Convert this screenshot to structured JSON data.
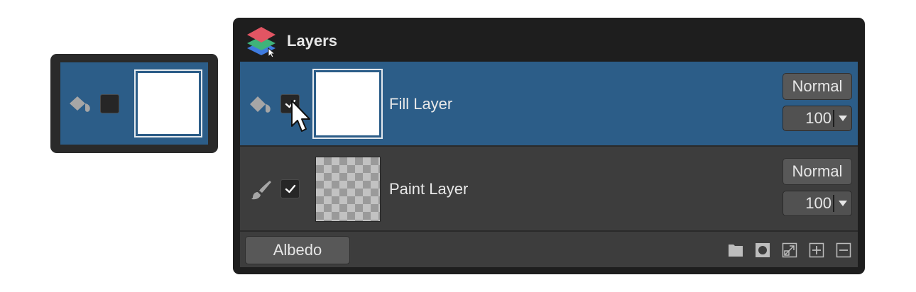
{
  "panel": {
    "title": "Layers"
  },
  "layers": [
    {
      "name": "Fill Layer",
      "type": "fill",
      "visible": true,
      "selected": true,
      "blend_mode": "Normal",
      "opacity": "100"
    },
    {
      "name": "Paint Layer",
      "type": "paint",
      "visible": true,
      "selected": false,
      "blend_mode": "Normal",
      "opacity": "100"
    }
  ],
  "footer": {
    "channel_button": "Albedo",
    "icons": [
      "folder-icon",
      "mask-icon",
      "resize-icon",
      "add-layer-icon",
      "remove-layer-icon"
    ]
  },
  "zoom_detail": {
    "description_icons": [
      "fill-bucket-icon",
      "checkbox",
      "white-thumbnail"
    ]
  },
  "colors": {
    "selected_row": "#2c5d88",
    "row_bg": "#3d3d3d",
    "panel_bg": "#1e1e1e",
    "button_bg": "#585858",
    "text": "#e6e6e6"
  }
}
